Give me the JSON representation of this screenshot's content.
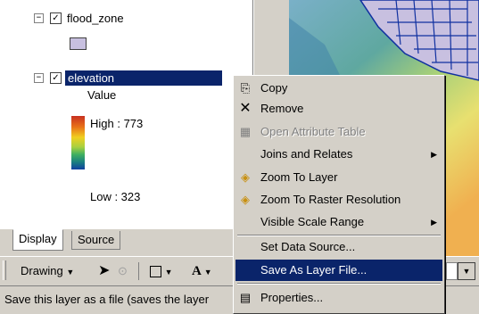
{
  "toc": {
    "layers": [
      {
        "name": "flood_zone",
        "checked": true,
        "expanded": true,
        "symbol_color": "#c8c0e0"
      },
      {
        "name": "elevation",
        "checked": true,
        "expanded": true,
        "selected": true
      }
    ],
    "elevation_legend": {
      "field": "Value",
      "high": "High : 773",
      "low": "Low : 323"
    },
    "tabs": {
      "display": "Display",
      "source": "Source"
    }
  },
  "toolbar": {
    "drawing": "Drawing",
    "text_tool": "A"
  },
  "status": {
    "text": "Save this layer as a file (saves the layer"
  },
  "context_menu": {
    "items": [
      {
        "label": "Copy",
        "icon": "copy-icon",
        "enabled": true
      },
      {
        "label": "Remove",
        "icon": "remove-icon",
        "enabled": true
      },
      {
        "label": "Open Attribute Table",
        "icon": "table-icon",
        "enabled": false
      },
      {
        "label": "Joins and Relates",
        "icon": "",
        "enabled": true,
        "submenu": true
      },
      {
        "label": "Zoom To Layer",
        "icon": "zoom-layer-icon",
        "enabled": true
      },
      {
        "label": "Zoom To Raster Resolution",
        "icon": "zoom-raster-icon",
        "enabled": true
      },
      {
        "label": "Visible Scale Range",
        "icon": "",
        "enabled": true,
        "submenu": true
      },
      {
        "label": "Set Data Source...",
        "icon": "",
        "enabled": true
      },
      {
        "label": "Save As Layer File...",
        "icon": "",
        "enabled": true,
        "highlighted": true
      },
      {
        "label": "Properties...",
        "icon": "properties-icon",
        "enabled": true
      }
    ]
  },
  "colors": {
    "selection": "#0a246a",
    "panel": "#d4d0c8"
  }
}
